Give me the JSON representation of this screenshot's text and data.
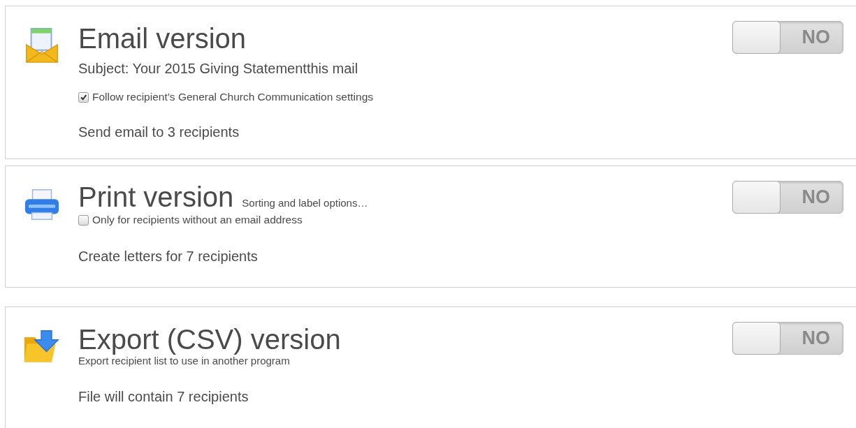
{
  "panels": [
    {
      "kind": "email",
      "title": "Email version",
      "subject": "Subject: Your 2015 Giving Statementthis mail",
      "checkbox": {
        "label": "Follow recipient’s General Church Communication settings",
        "checked": true
      },
      "summary": "Send email to 3 recipients",
      "toggle": {
        "label": "NO",
        "on": false
      }
    },
    {
      "kind": "print",
      "title": "Print version",
      "title_link": "Sorting and label options…",
      "checkbox": {
        "label": "Only for recipients without an email address",
        "checked": false
      },
      "summary": "Create letters for 7 recipients",
      "toggle": {
        "label": "NO",
        "on": false
      }
    },
    {
      "kind": "export",
      "title": "Export (CSV) version",
      "note": "Export recipient list to use in another program",
      "summary": "File will contain 7 recipients",
      "toggle": {
        "label": "NO",
        "on": false
      }
    }
  ]
}
